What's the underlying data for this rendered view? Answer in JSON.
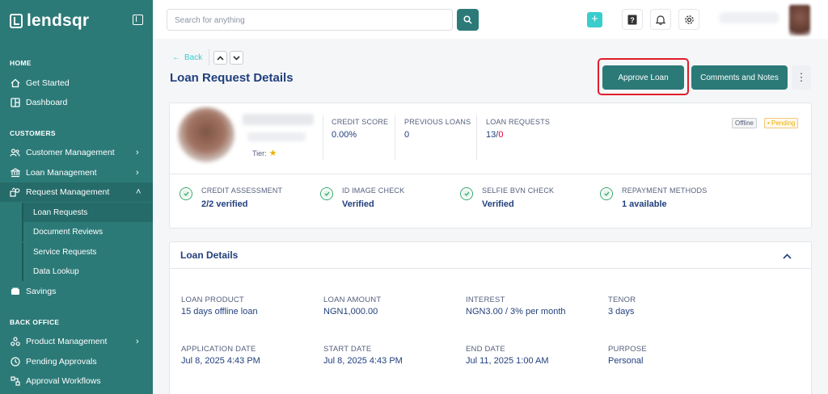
{
  "brand": {
    "name": "lendsqr"
  },
  "sidebar": {
    "sections": {
      "home": "HOME",
      "customers": "CUSTOMERS",
      "back_office": "BACK OFFICE"
    },
    "items": {
      "get_started": "Get Started",
      "dashboard": "Dashboard",
      "customer_management": "Customer Management",
      "loan_management": "Loan Management",
      "request_management": "Request Management",
      "loan_requests": "Loan Requests",
      "document_reviews": "Document Reviews",
      "service_requests": "Service Requests",
      "data_lookup": "Data Lookup",
      "savings": "Savings",
      "product_management": "Product Management",
      "pending_approvals": "Pending Approvals",
      "approval_workflows": "Approval Workflows"
    }
  },
  "topbar": {
    "search_placeholder": "Search for anything"
  },
  "page": {
    "back": "Back",
    "title": "Loan Request Details",
    "approve_button": "Approve Loan",
    "comments_button": "Comments and Notes"
  },
  "profile": {
    "tier_label": "Tier:",
    "tier_stars": 1,
    "credit_score_label": "CREDIT SCORE",
    "credit_score": "0.00%",
    "previous_loans_label": "PREVIOUS LOANS",
    "previous_loans": "0",
    "loan_requests_label": "LOAN REQUESTS",
    "loan_requests_total": "13",
    "loan_requests_sep": "/",
    "loan_requests_failed": "0",
    "status_offline": "Offline",
    "status_pending": "• Pending"
  },
  "verifications": [
    {
      "label": "CREDIT ASSESSMENT",
      "value": "2/2 verified"
    },
    {
      "label": "ID IMAGE CHECK",
      "value": "Verified"
    },
    {
      "label": "SELFIE BVN CHECK",
      "value": "Verified"
    },
    {
      "label": "REPAYMENT METHODS",
      "value": "1 available"
    }
  ],
  "loan_details": {
    "title": "Loan Details",
    "fields": [
      {
        "label": "LOAN PRODUCT",
        "value": "15 days offline loan"
      },
      {
        "label": "LOAN AMOUNT",
        "value": "NGN1,000.00"
      },
      {
        "label": "INTEREST",
        "value": "NGN3.00 / 3% per month"
      },
      {
        "label": "TENOR",
        "value": "3 days"
      },
      {
        "label": "APPLICATION DATE",
        "value": "Jul 8, 2025 4:43 PM"
      },
      {
        "label": "START DATE",
        "value": "Jul 8, 2025 4:43 PM"
      },
      {
        "label": "END DATE",
        "value": "Jul 11, 2025 1:00 AM"
      },
      {
        "label": "PURPOSE",
        "value": "Personal"
      }
    ]
  },
  "colors": {
    "primary": "#2b7a78",
    "accent": "#39cdcc",
    "title": "#213f7d",
    "highlight": "#e11d2a"
  }
}
